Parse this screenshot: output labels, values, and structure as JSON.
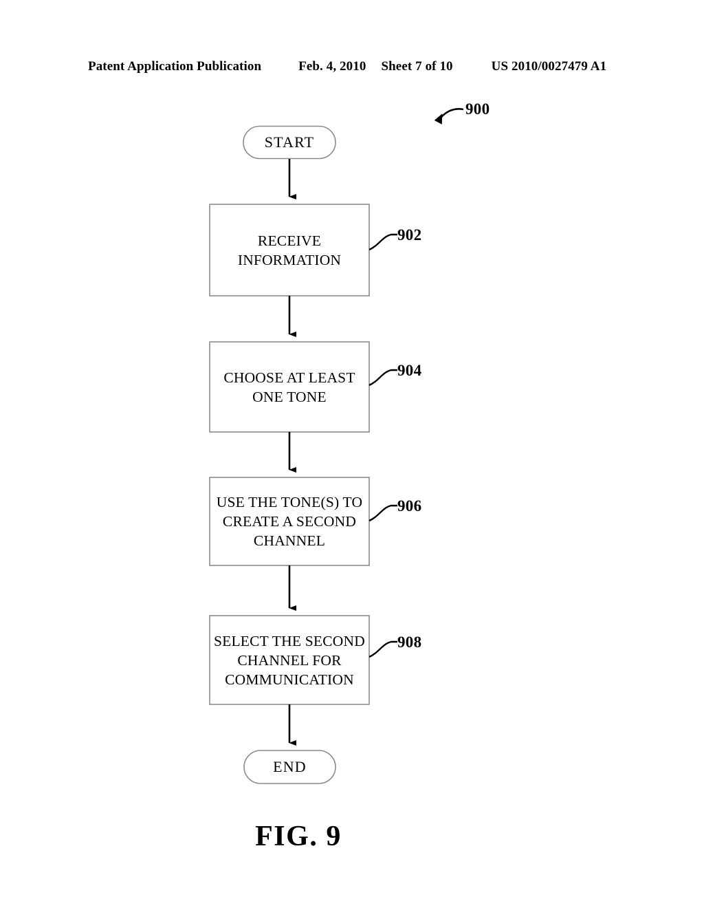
{
  "header": {
    "publication": "Patent Application Publication",
    "date": "Feb. 4, 2010",
    "sheet": "Sheet 7 of 10",
    "patent_number": "US 2010/0027479 A1"
  },
  "figure": {
    "caption": "FIG. 9",
    "diagram_reference": "900"
  },
  "flowchart": {
    "type": "flowchart",
    "orientation": "vertical",
    "start": {
      "label": "START",
      "shape": "terminator"
    },
    "end": {
      "label": "END",
      "shape": "terminator"
    },
    "steps": [
      {
        "ref": "902",
        "label": "RECEIVE\nINFORMATION",
        "shape": "process"
      },
      {
        "ref": "904",
        "label": "CHOOSE AT LEAST\nONE TONE",
        "shape": "process"
      },
      {
        "ref": "906",
        "label": "USE THE TONE(S) TO\nCREATE A SECOND\nCHANNEL",
        "shape": "process"
      },
      {
        "ref": "908",
        "label": "SELECT THE SECOND\nCHANNEL FOR\nCOMMUNICATION",
        "shape": "process"
      }
    ],
    "colors": {
      "stroke": "#8a8a8a",
      "arrow": "#000000",
      "text": "#000000",
      "background": "#ffffff"
    }
  }
}
